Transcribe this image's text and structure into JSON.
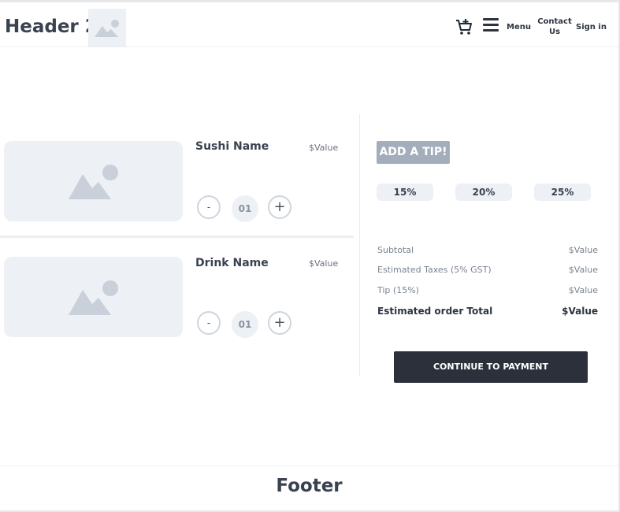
{
  "header": {
    "title": "Header 2",
    "nav": {
      "menu": "Menu",
      "contact": "Contact Us",
      "signin": "Sign in"
    }
  },
  "items": [
    {
      "name": "Sushi Name",
      "price": "$Value",
      "qty": "01",
      "minus": "-",
      "plus": "+"
    },
    {
      "name": "Drink Name",
      "price": "$Value",
      "qty": "01",
      "minus": "-",
      "plus": "+"
    }
  ],
  "tip": {
    "title": "ADD A TIP!",
    "options": [
      "15%",
      "20%",
      "25%"
    ]
  },
  "summary": {
    "subtotal_label": "Subtotal",
    "subtotal_value": "$Value",
    "tax_label": "Estimated Taxes (5% GST)",
    "tax_value": "$Value",
    "tip_label": "Tip (15%)",
    "tip_value": "$Value",
    "total_label": "Estimated order Total",
    "total_value": "$Value"
  },
  "cta": "CONTINUE TO PAYMENT",
  "footer": "Footer",
  "colors": {
    "primary": "#2b303b",
    "muted": "#edf0f4",
    "tip_badge": "#a4adbb"
  },
  "icons": [
    "cart-icon",
    "hamburger-icon",
    "image-placeholder-icon"
  ]
}
